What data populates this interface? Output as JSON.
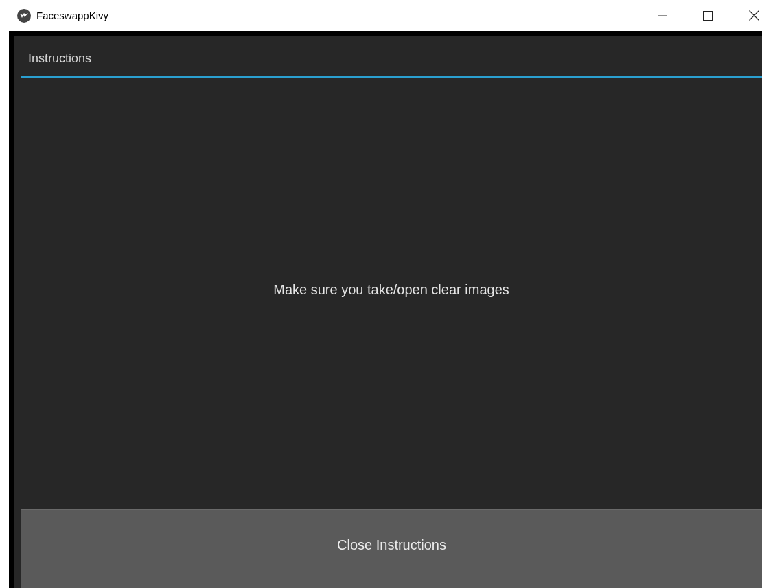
{
  "window": {
    "title": "FaceswappKivy"
  },
  "popup": {
    "title": "Instructions",
    "message": "Make sure you take/open clear images",
    "button": "Close Instructions"
  }
}
